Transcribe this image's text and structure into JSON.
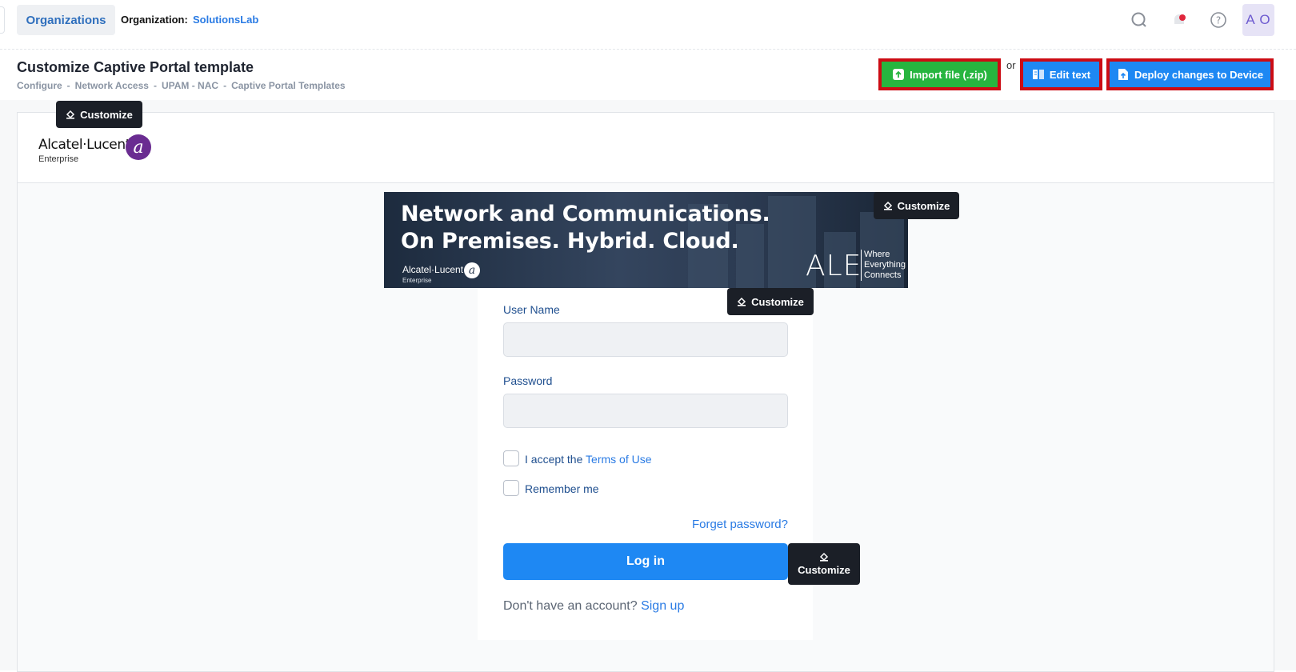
{
  "topbar": {
    "organizations_tab": "Organizations",
    "organization_label": "Organization:",
    "organization_name": "SolutionsLab",
    "avatar_initials": "A O",
    "icons": [
      "search-icon",
      "notification-bell-icon",
      "help-icon"
    ]
  },
  "header": {
    "title": "Customize Captive Portal template",
    "breadcrumb": [
      "Configure",
      "Network Access",
      "UPAM - NAC",
      "Captive Portal Templates"
    ],
    "breadcrumb_sep": "-",
    "import_button": "Import file (.zip)",
    "or_text": "or",
    "edit_text_button": "Edit text",
    "deploy_button": "Deploy changes to Device"
  },
  "portal": {
    "customize_label": "Customize",
    "logo": {
      "brand": "Alcatel·Lucent",
      "sub": "Enterprise"
    },
    "banner": {
      "line1": "Network and Communications.",
      "line2": "On Premises. Hybrid. Cloud.",
      "brand": "Alcatel·Lucent",
      "brand_sub": "Enterprise",
      "ale": "ALE",
      "tagline_1": "Where",
      "tagline_2": "Everything",
      "tagline_3": "Connects"
    },
    "form": {
      "username_label": "User Name",
      "password_label": "Password",
      "accept_prefix": "I accept the",
      "terms_link": "Terms of Use",
      "remember_label": "Remember me",
      "forgot_link": "Forget password?",
      "login_button": "Log in",
      "signup_prefix": "Don't have an account?",
      "signup_link": "Sign up"
    }
  },
  "colors": {
    "import_green": "#27b53f",
    "primary_blue": "#1e88f3",
    "highlight_red": "#cc0c14",
    "customize_dark": "#1b1f27",
    "brand_purple": "#6a2c91"
  }
}
